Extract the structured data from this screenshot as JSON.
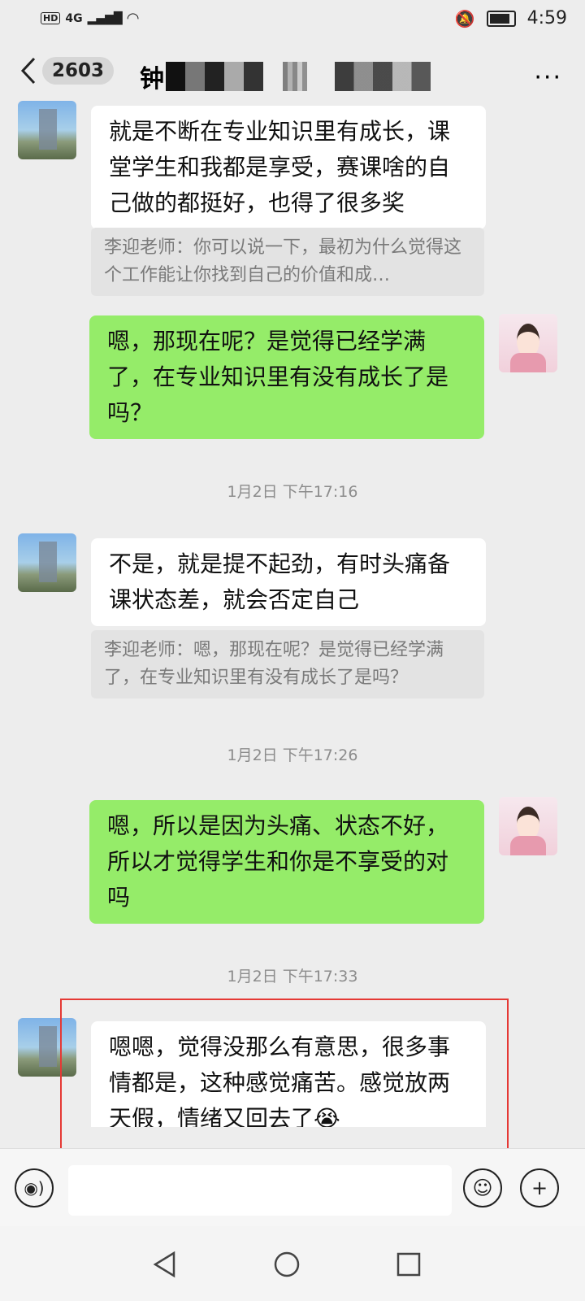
{
  "status_bar": {
    "network": "4G",
    "hd": "HD",
    "time": "4:59"
  },
  "header": {
    "back_count": "2603",
    "title_visible": "钟",
    "more_label": "···"
  },
  "messages": [
    {
      "text": "就是不断在专业知识里有成长，课堂学生和我都是享受，赛课啥的自己做的都挺好，也得了很多奖"
    },
    {
      "quote": "李迎老师：你可以说一下，最初为什么觉得这个工作能让你找到自己的价值和成…"
    },
    {
      "text": "嗯，那现在呢？是觉得已经学满了，在专业知识里有没有成长了是吗？"
    },
    {
      "time": "1月2日 下午17:16"
    },
    {
      "text": "不是，就是提不起劲，有时头痛备课状态差，就会否定自己"
    },
    {
      "quote": "李迎老师：嗯，那现在呢？是觉得已经学满了，在专业知识里有没有成长了是吗？"
    },
    {
      "time": "1月2日 下午17:26"
    },
    {
      "text": "嗯，所以是因为头痛、状态不好，所以才觉得学生和你是不享受的对吗"
    },
    {
      "time": "1月2日 下午17:33"
    },
    {
      "text": "嗯嗯，觉得没那么有意思，很多事情都是，这种感觉痛苦。感觉放两天假，情绪又回去了😭"
    }
  ],
  "input": {
    "placeholder": ""
  },
  "colors": {
    "bg": "#ededed",
    "green_bubble": "#95ec69",
    "highlight": "#e53935"
  }
}
